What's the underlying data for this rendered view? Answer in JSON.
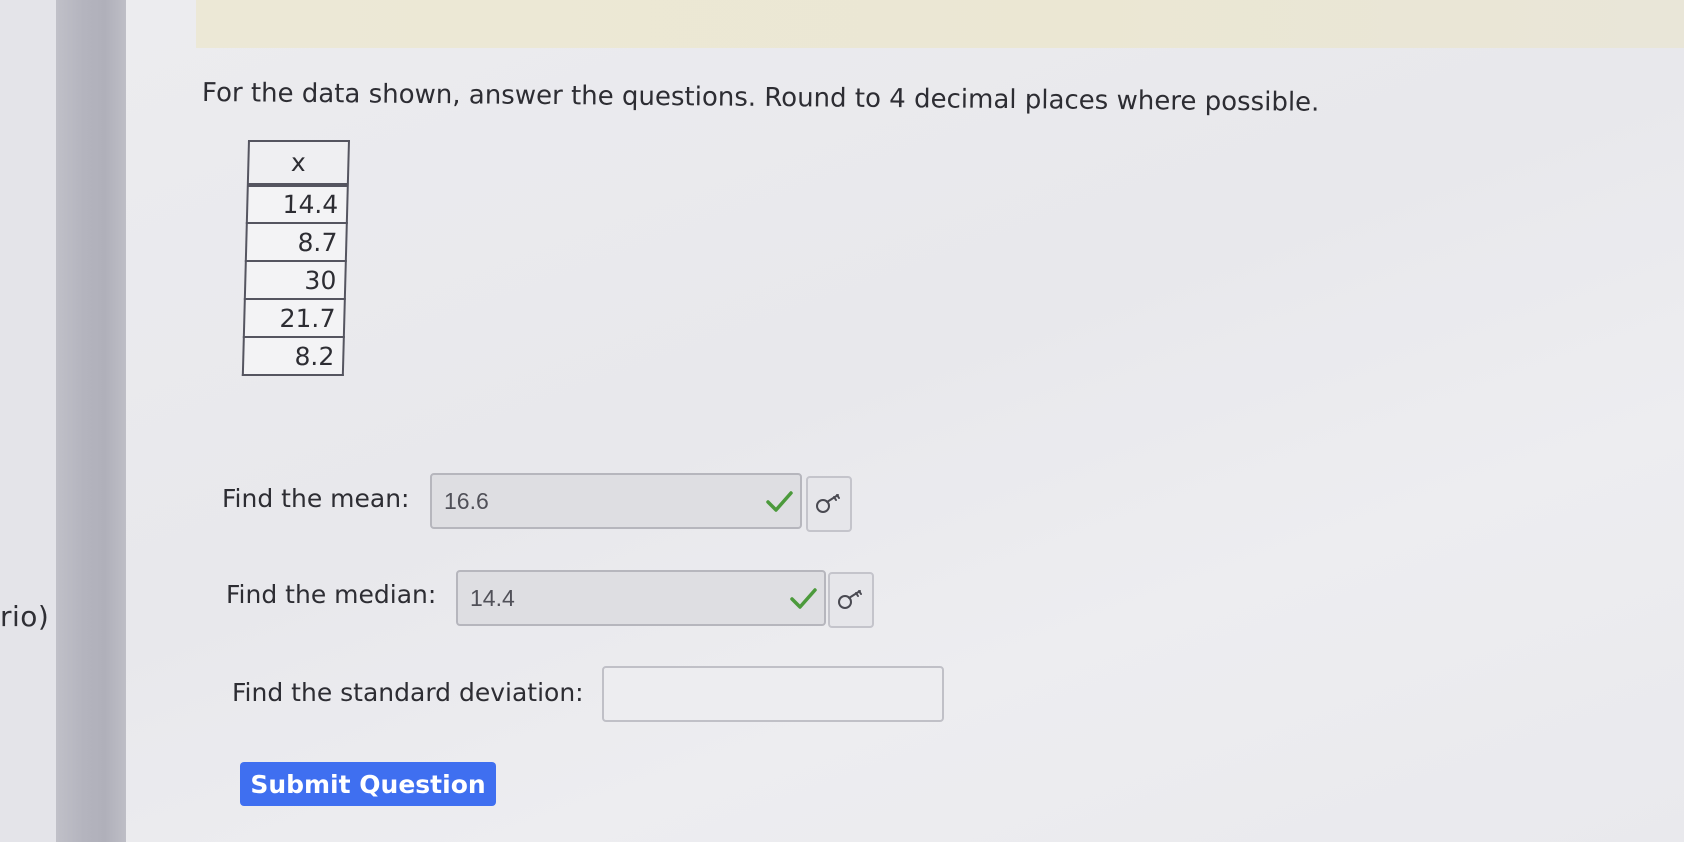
{
  "sidebar": {
    "partial_text": "rio)"
  },
  "question": {
    "instructions": "For the data shown, answer the questions. Round to 4 decimal places where possible.",
    "table": {
      "header": "x",
      "values": [
        "14.4",
        "8.7",
        "30",
        "21.7",
        "8.2"
      ]
    },
    "mean": {
      "label": "Find the mean:",
      "value": "16.6",
      "status": "correct",
      "status_icon": "check-icon",
      "key_icon": "key-icon"
    },
    "median": {
      "label": "Find the median:",
      "value": "14.4",
      "status": "correct",
      "status_icon": "check-icon",
      "key_icon": "key-icon"
    },
    "std_dev": {
      "label": "Find the standard deviation:",
      "value": ""
    },
    "submit_label": "Submit Question"
  },
  "colors": {
    "accent": "#3f6ff0",
    "correct": "#4c9a3c"
  }
}
